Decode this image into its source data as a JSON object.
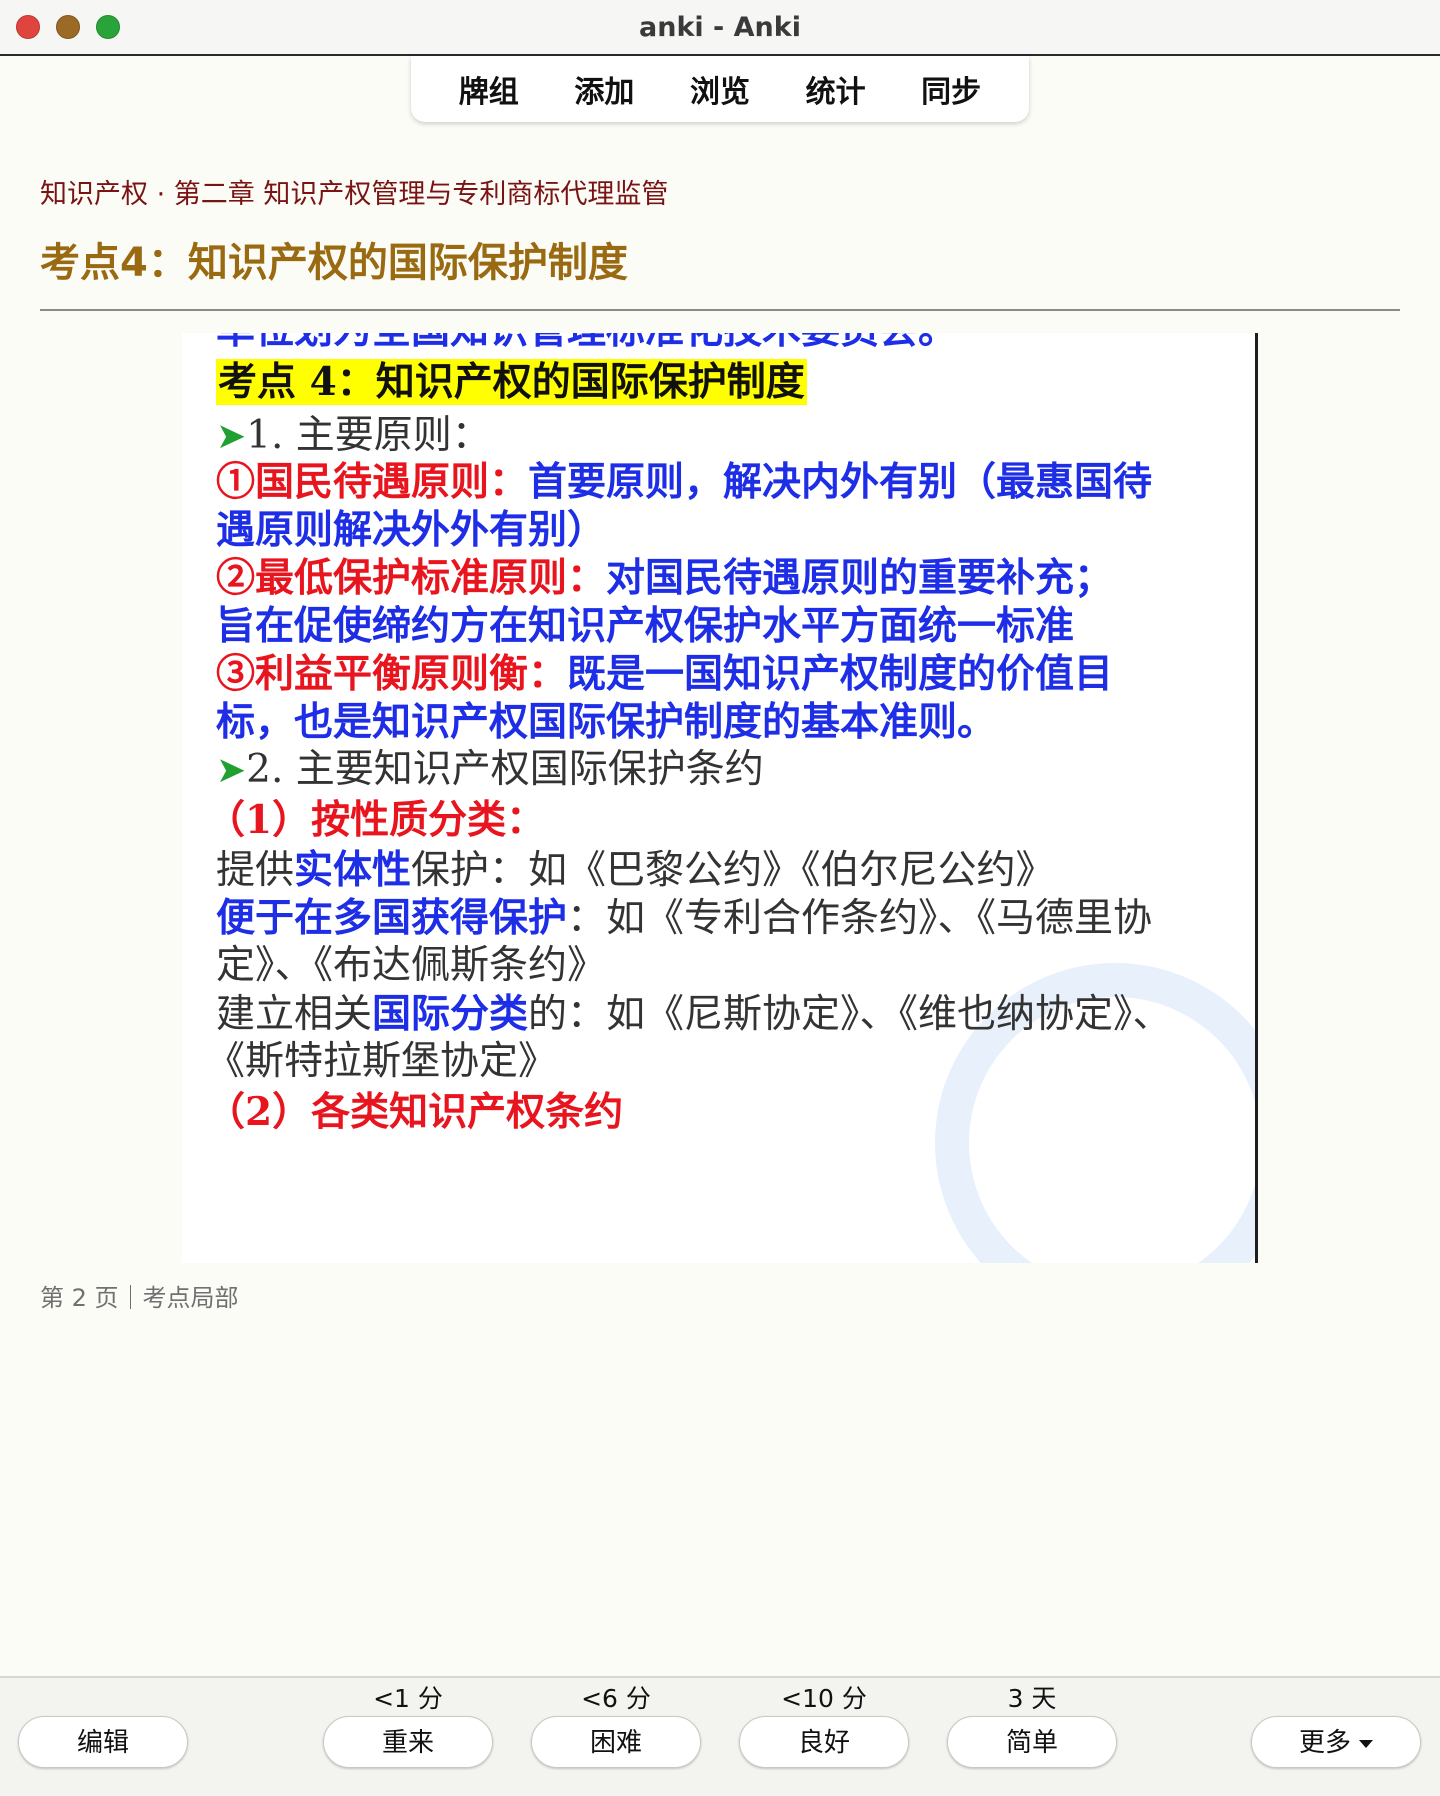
{
  "window": {
    "title": "anki - Anki"
  },
  "nav": {
    "items": [
      "牌组",
      "添加",
      "浏览",
      "统计",
      "同步"
    ]
  },
  "header": {
    "breadcrumb": "知识产权 · 第二章 知识产权管理与专利商标代理监管",
    "title": "考点4：知识产权的国际保护制度"
  },
  "slide": {
    "cut_top": "单位划为全国知识管理标准化技术委员会。",
    "heading": "考点 4：知识产权的国际保护制度",
    "s1_label": "1.   主要原则：",
    "p1_red": "①国民待遇原则：",
    "p1_blue": "首要原则，解决内外有别（最惠国待",
    "p1_blue2": "遇原则解决外外有别）",
    "p2_red": "②最低保护标准原则：",
    "p2_blue": "对国民待遇原则的重要补充；",
    "p2_blue2": "旨在促使缔约方在知识产权保护水平方面统一标准",
    "p3_red": "③利益平衡原则衡：",
    "p3_blue": "既是一国知识产权制度的价值目",
    "p3_blue2": "标，也是知识产权国际保护制度的基本准则。",
    "s2_label": "2. 主要知识产权国际保护条约",
    "sub1": "（1）按性质分类：",
    "l1_a": "提供",
    "l1_b": "实体性",
    "l1_c": "保护：如《巴黎公约》《伯尔尼公约》",
    "l2_a": "便于在多国获得保护",
    "l2_b": "：如《专利合作条约》、《马德里协",
    "l2_c": "定》、《布达佩斯条约》",
    "l3_a": "建立相关",
    "l3_b": "国际分类",
    "l3_c": "的：如《尼斯协定》、《维也纳协定》、",
    "l3_d": "《斯特拉斯堡协定》",
    "sub2": "（2）各类知识产权条约"
  },
  "page_note": "第 2 页｜考点局部",
  "answer": {
    "edit_label": "编辑",
    "more_label": "更多",
    "buttons": [
      {
        "interval": "<1 分",
        "label": "重来"
      },
      {
        "interval": "<6 分",
        "label": "困难"
      },
      {
        "interval": "<10 分",
        "label": "良好"
      },
      {
        "interval": "3 天",
        "label": "简单"
      }
    ]
  }
}
